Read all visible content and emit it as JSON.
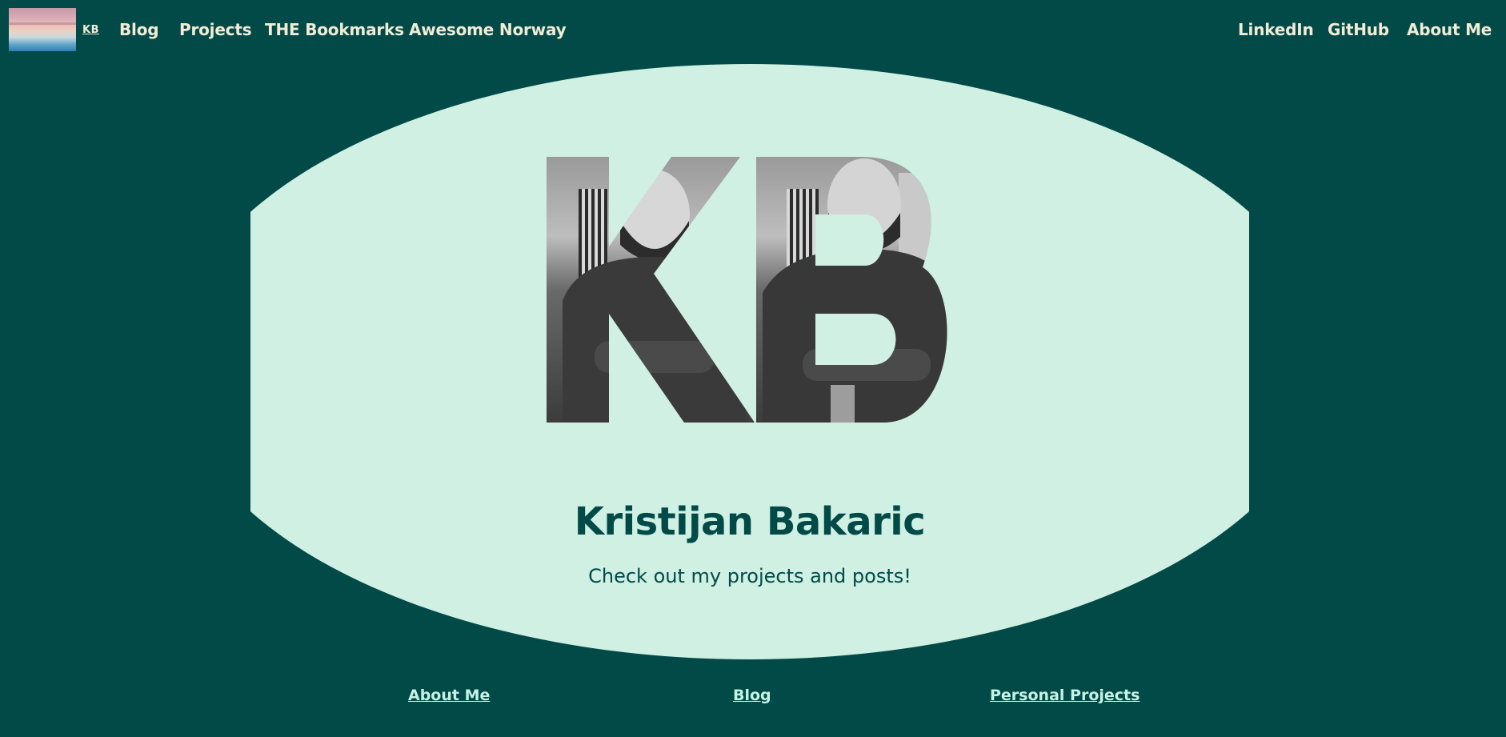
{
  "nav": {
    "logo_text": "KB",
    "left_items": [
      "Blog",
      "Projects",
      "THE Bookmarks",
      "Awesome Norway"
    ],
    "right_items": [
      "LinkedIn",
      "GitHub",
      "About Me"
    ]
  },
  "hero": {
    "monogram": "KB",
    "title": "Kristijan Bakaric",
    "subtitle": "Check out my projects and posts!"
  },
  "footer": {
    "links": [
      "About Me",
      "Blog",
      "Personal Projects"
    ]
  },
  "colors": {
    "page_bg": "#024a48",
    "hero_bg": "#cff0e3",
    "nav_text": "#f2ecd6",
    "footer_link": "#c5f2e4",
    "title": "#024a48"
  }
}
